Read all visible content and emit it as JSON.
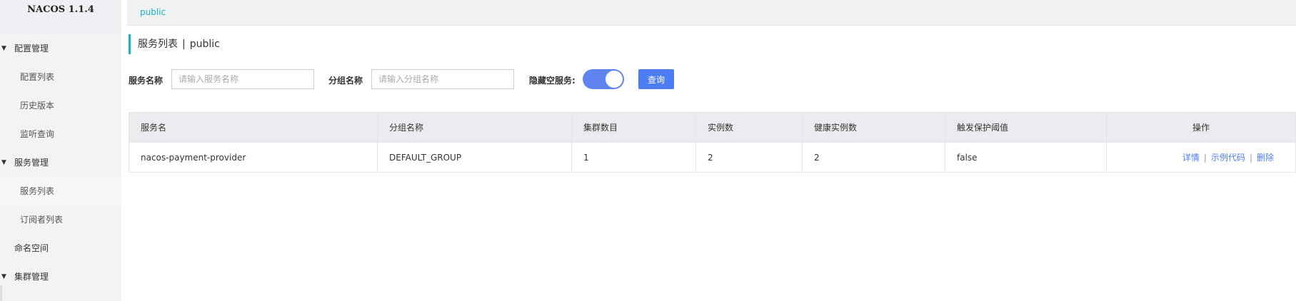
{
  "sidebar": {
    "brand": "NACOS 1.1.4",
    "groups": {
      "config": "配置管理",
      "service": "服务管理",
      "namespace": "命名空间",
      "cluster": "集群管理"
    },
    "items": {
      "config_list": "配置列表",
      "history": "历史版本",
      "listener": "监听查询",
      "service_list": "服务列表",
      "subscriber_list": "订阅者列表"
    }
  },
  "topbar": {
    "namespace": "public"
  },
  "page": {
    "title": "服务列表",
    "separator": "|",
    "namespace": "public"
  },
  "filters": {
    "service_name_label": "服务名称",
    "service_name_placeholder": "请输入服务名称",
    "group_name_label": "分组名称",
    "group_name_placeholder": "请输入分组名称",
    "hide_empty_label": "隐藏空服务:",
    "hide_empty_on": true,
    "query_button": "查询"
  },
  "table": {
    "headers": [
      "服务名",
      "分组名称",
      "集群数目",
      "实例数",
      "健康实例数",
      "触发保护阈值",
      "操作"
    ],
    "rows": [
      {
        "service": "nacos-payment-provider",
        "group": "DEFAULT_GROUP",
        "clusters": "1",
        "instances": "2",
        "healthy": "2",
        "threshold": "false",
        "actions": [
          "详情",
          "示例代码",
          "删除"
        ],
        "action_sep": "|"
      }
    ]
  },
  "colors": {
    "accent": "#1ab1c4",
    "primary": "#4d7df4",
    "toggle": "#5f84f0"
  }
}
